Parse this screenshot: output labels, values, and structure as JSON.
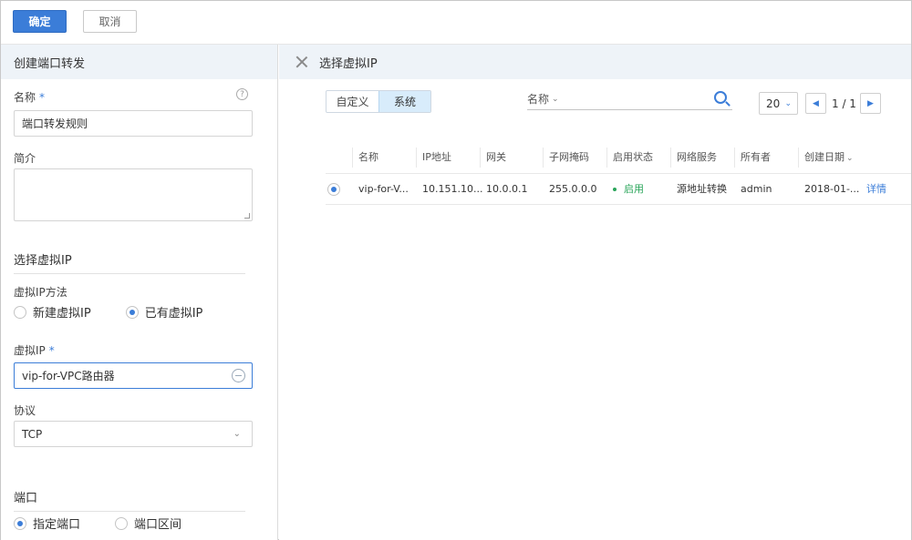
{
  "toolbar": {
    "confirm_label": "确定",
    "cancel_label": "取消"
  },
  "left": {
    "title": "创建端口转发",
    "name_label": "名称",
    "required_mark": "*",
    "name_value": "端口转发规则",
    "desc_label": "简介",
    "vip_section_title": "选择虚拟IP",
    "vip_method_label": "虚拟IP方法",
    "vip_method_options": [
      "新建虚拟IP",
      "已有虚拟IP"
    ],
    "vip_method_selected": "已有虚拟IP",
    "vip_label": "虚拟IP",
    "vip_value": "vip-for-VPC路由器",
    "protocol_label": "协议",
    "protocol_value": "TCP",
    "port_section_title": "端口",
    "port_options": [
      "指定端口",
      "端口区间"
    ],
    "port_selected": "指定端口",
    "help_glyph": "?"
  },
  "right": {
    "title": "选择虚拟IP",
    "tabs": [
      "自定义",
      "系统"
    ],
    "active_tab": "系统",
    "search_field": "名称",
    "page_size": "20",
    "page_indicator": "1 / 1",
    "columns": [
      "名称",
      "IP地址",
      "网关",
      "子网掩码",
      "启用状态",
      "网络服务",
      "所有者",
      "创建日期"
    ],
    "rows": [
      {
        "name": "vip-for-V...",
        "ip": "10.151.10...",
        "gateway": "10.0.0.1",
        "netmask": "255.0.0.0",
        "status": "启用",
        "service": "源地址转换",
        "owner": "admin",
        "created": "2018-01-...",
        "action": "详情"
      }
    ]
  },
  "colors": {
    "accent": "#3b7dd8",
    "status_green": "#2aa55a",
    "header_bg": "#eef3f8"
  },
  "icons": [
    "help-icon",
    "close-icon",
    "search-icon",
    "chevron-down-icon",
    "chevron-left-icon",
    "chevron-right-icon",
    "remove-icon"
  ]
}
